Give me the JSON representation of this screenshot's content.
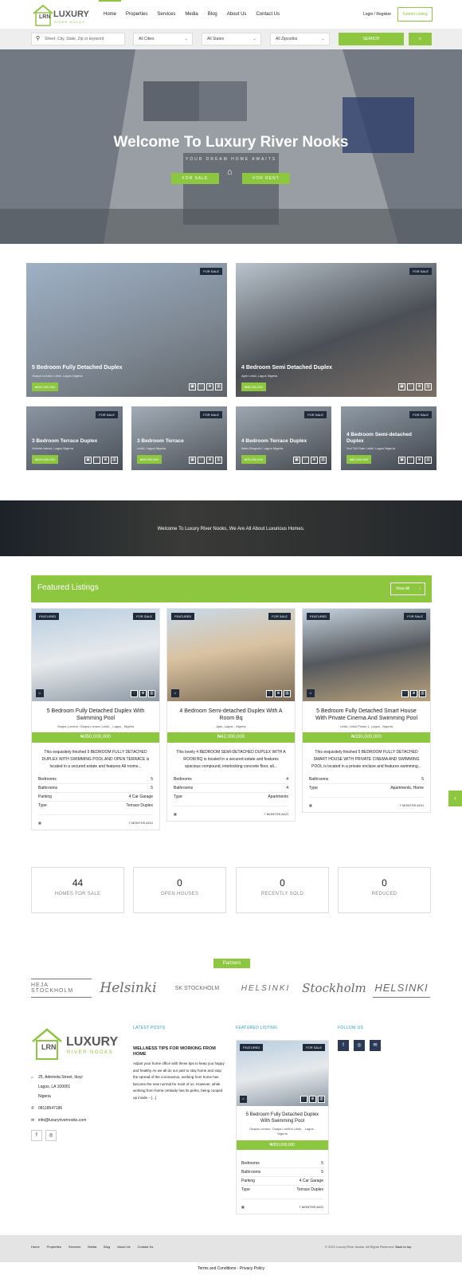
{
  "brand": {
    "name": "LUXURY",
    "sub": "RIVER NOOKS",
    "mark": "LRN"
  },
  "nav": [
    "Home",
    "Properties",
    "Services",
    "Media",
    "Blog",
    "About Us",
    "Contact Us"
  ],
  "header": {
    "login": "Login / Register",
    "submit": "Submit Listing"
  },
  "search": {
    "placeholder": "Street, City, State, Zip or keyword",
    "cities": "All Cities",
    "states": "All States",
    "zipcodes": "All Zipcodes",
    "button": "SEARCH"
  },
  "hero": {
    "title": "Welcome To Luxury River Nooks",
    "subtitle": "YOUR DREAM HOME AWAITS",
    "sale": "FOR SALE",
    "rent": "FOR RENT"
  },
  "tiles": [
    {
      "badge": "FOR SALE",
      "title": "5 Bedroom Fully Detached Duplex",
      "location": "Osapa London Lekki, Lagos Nigeria",
      "price": "₦340,000,000"
    },
    {
      "badge": "FOR SALE",
      "title": "4 Bedroom Semi Detached Duplex",
      "location": "Ajah Lekki, Lagos Nigeria",
      "price": "₦48,000,000"
    },
    {
      "badge": "FOR SALE",
      "title": "3 Bedroom Terrace Duplex",
      "location": "Victoria Island, Lagos Nigeria",
      "price": "₦220,000,000"
    },
    {
      "badge": "FOR SALE",
      "title": "3 Bedroom Terrace",
      "location": "Lekki, Lagos Nigeria",
      "price": "₦35,000,000"
    },
    {
      "badge": "FOR SALE",
      "title": "4 Bedroom Terrace Duplex",
      "location": "Ikate-Elegushi, Lagos Nigeria",
      "price": "₦75,000,000"
    },
    {
      "badge": "FOR SALE",
      "title": "4 Bedroom Semi-detached Duplex",
      "location": "2nd Toll Gate Lekki, Lagos Nigeria",
      "price": "₦62,000,000"
    }
  ],
  "banner": "Welcome To Luxury River Nooks, We Are All About Luxurious Homes.",
  "featured": {
    "title": "Featured Listings",
    "view_all": "View All",
    "cards": [
      {
        "featured": "FEATURED",
        "sale": "FOR SALE",
        "title": "5 Bedroom Fully Detached Duplex With Swimming Pool",
        "location": "Osapa London, Osapa London Lekki, , Lagos , Nigeria",
        "price": "₦350,000,000",
        "desc": "This exquisitely finished 5 BEDROOM FULLY DETACHED DUPLEX WITH SWIMMING POOL AND OPEN TERRACE is located in a secured estate and features All rooms...",
        "rows": [
          [
            "Bedrooms",
            "5"
          ],
          [
            "Bathrooms",
            "5"
          ],
          [
            "Parking",
            "4 Car Garage"
          ],
          [
            "Type",
            "Terrace Duplex"
          ]
        ],
        "ago": "7 MONTHS AGO"
      },
      {
        "featured": "FEATURED",
        "sale": "FOR SALE",
        "title": "4 Bedroom Semi-detached Duplex With A Room Bq",
        "location": "Ajah, Lagos , Nigeria",
        "price": "₦42,000,000",
        "desc": "This lovely 4 BEDROOM SEMI-DETACHED DUPLEX WITH A ROOM BQ is located in a secured estate and features spacious compound, interlocking concrete floor, all...",
        "rows": [
          [
            "Bedrooms",
            "4"
          ],
          [
            "Bathrooms",
            "4"
          ],
          [
            "Type",
            "Apartments"
          ]
        ],
        "ago": "7 MONTHS AGO"
      },
      {
        "featured": "FEATURED",
        "sale": "FOR SALE",
        "title": "5 Bedroom Fully Detached Smart House With Private Cinema And Swimming Pool",
        "location": "Lekki, Lekki Phase 1, Lagos , Nigeria",
        "price": "₦330,000,000",
        "desc": "This exquisitely finished 5 BEDROOM FULLY DETACHED SMART HOUSE WITH PRIVATE CINEMA AND SWIMMING POOL is located in a private enclave and features swimming...",
        "rows": [
          [
            "Bathrooms",
            "5"
          ],
          [
            "Type",
            "Apartments, Home"
          ]
        ],
        "ago": "7 MONTHS AGO"
      }
    ]
  },
  "stats": [
    {
      "n": "44",
      "l": "HOMES FOR SALE"
    },
    {
      "n": "0",
      "l": "OPEN HOUSES"
    },
    {
      "n": "0",
      "l": "RECENTLY SOLD"
    },
    {
      "n": "0",
      "l": "REDUCED"
    }
  ],
  "partners": {
    "title": "Partners",
    "logos": [
      "HEJA STOCKHOLM",
      "Helsinki",
      "SK STOCKHOLM",
      "HELSINKI",
      "Stockholm",
      "HELSINKI"
    ]
  },
  "footer": {
    "address": [
      "25, Ademola Street, Ikoyi",
      "Lagos, LA 100001",
      "Nigeria"
    ],
    "phone": "08118547186",
    "email": "info@luxuryrivernooks.com",
    "latest_posts": "LATEST POSTS",
    "post_title": "WELLNESS TIPS FOR WORKING FROM HOME",
    "post_body": "Adjust your home office with these tips to keep you happy and healthy As we all do our part to stay home and stop the spread of the coronavirus, working from home has become the new normal for most of us. However, while working from home certainly has its perks, being cooped up inside – [...]",
    "featured_listing": "FEATURED LISTING",
    "follow_us": "FOLLOW US",
    "card": {
      "featured": "FEATURED",
      "sale": "FOR SALE",
      "title": "5 Bedroom Fully Detached Duplex With Swimming Pool",
      "location": "Osapa London, Osapa London Lekki, , Lagos , Nigeria",
      "price": "₦350,000,000",
      "rows": [
        [
          "Bedrooms",
          "5"
        ],
        [
          "Bathrooms",
          "5"
        ],
        [
          "Parking",
          "4 Car Garage"
        ],
        [
          "Type",
          "Terrace Duplex"
        ]
      ],
      "ago": "7 MONTHS AGO"
    },
    "bottom_nav": [
      "Home",
      "Properties",
      "Services",
      "Media",
      "Blog",
      "About Us",
      "Contact Us"
    ],
    "copyright": "© 2021 Luxury River Nooks, All Rights Reserved.",
    "back_to_top": "Back to top",
    "terms": "Terms and Conditions",
    "privacy": "Privacy Policy"
  },
  "colors": {
    "accent": "#8dc63f",
    "dark": "#1f2a3a",
    "link": "#1da1c8"
  }
}
